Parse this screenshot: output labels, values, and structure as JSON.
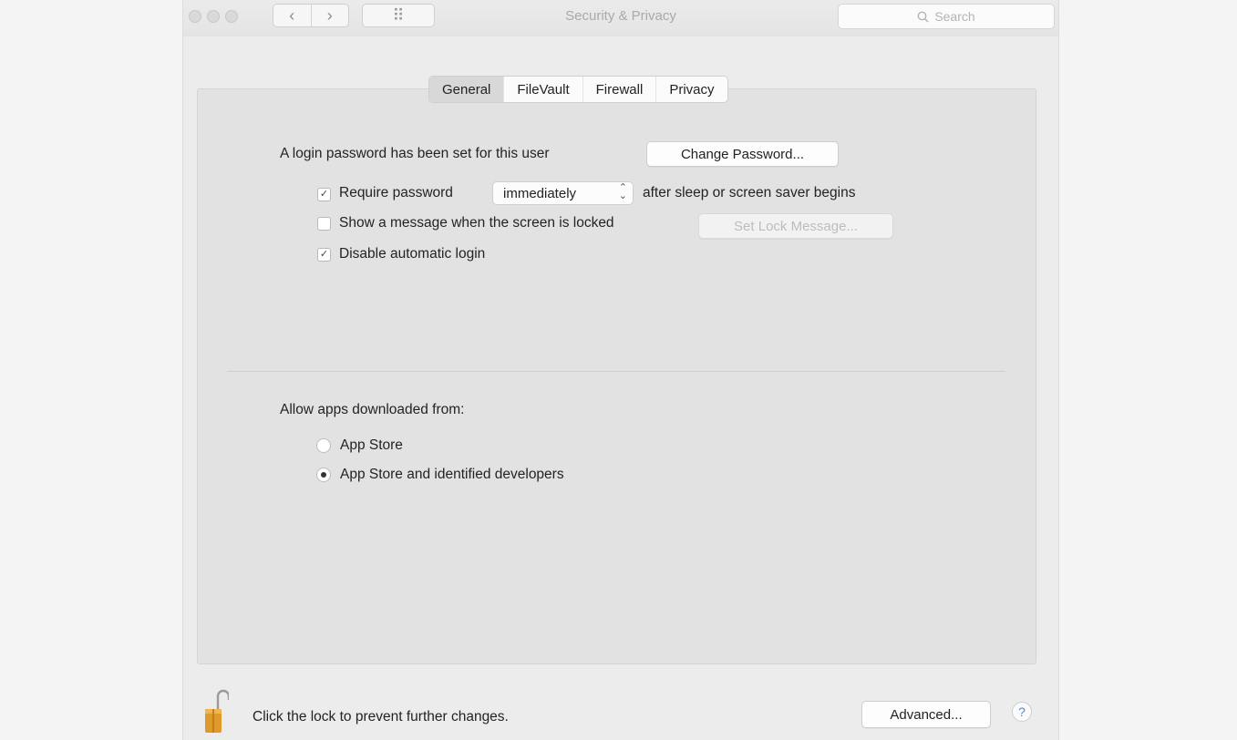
{
  "window": {
    "title": "Security & Privacy"
  },
  "toolbar": {
    "back_icon": "‹",
    "forward_icon": "›",
    "grid_icon": "⠿",
    "search_placeholder": "Search"
  },
  "tabs": [
    {
      "label": "General",
      "active": true
    },
    {
      "label": "FileVault",
      "active": false
    },
    {
      "label": "Firewall",
      "active": false
    },
    {
      "label": "Privacy",
      "active": false
    }
  ],
  "general": {
    "login_password_text": "A login password has been set for this user",
    "change_password_label": "Change Password...",
    "require_password": {
      "label": "Require password",
      "checked": true
    },
    "require_password_delay": "immediately",
    "after_sleep_text": "after sleep or screen saver begins",
    "show_message": {
      "label": "Show a message when the screen is locked",
      "checked": false
    },
    "set_lock_message_label": "Set Lock Message...",
    "disable_auto_login": {
      "label": "Disable automatic login",
      "checked": true
    },
    "allow_apps_label": "Allow apps downloaded from:",
    "allow_options": [
      {
        "label": "App Store",
        "selected": false
      },
      {
        "label": "App Store and identified developers",
        "selected": true
      }
    ]
  },
  "footer": {
    "lock_text": "Click the lock to prevent further changes.",
    "advanced_label": "Advanced...",
    "help_label": "?"
  },
  "colors": {
    "lock": "#e09a2c",
    "help": "#4a8be0"
  }
}
